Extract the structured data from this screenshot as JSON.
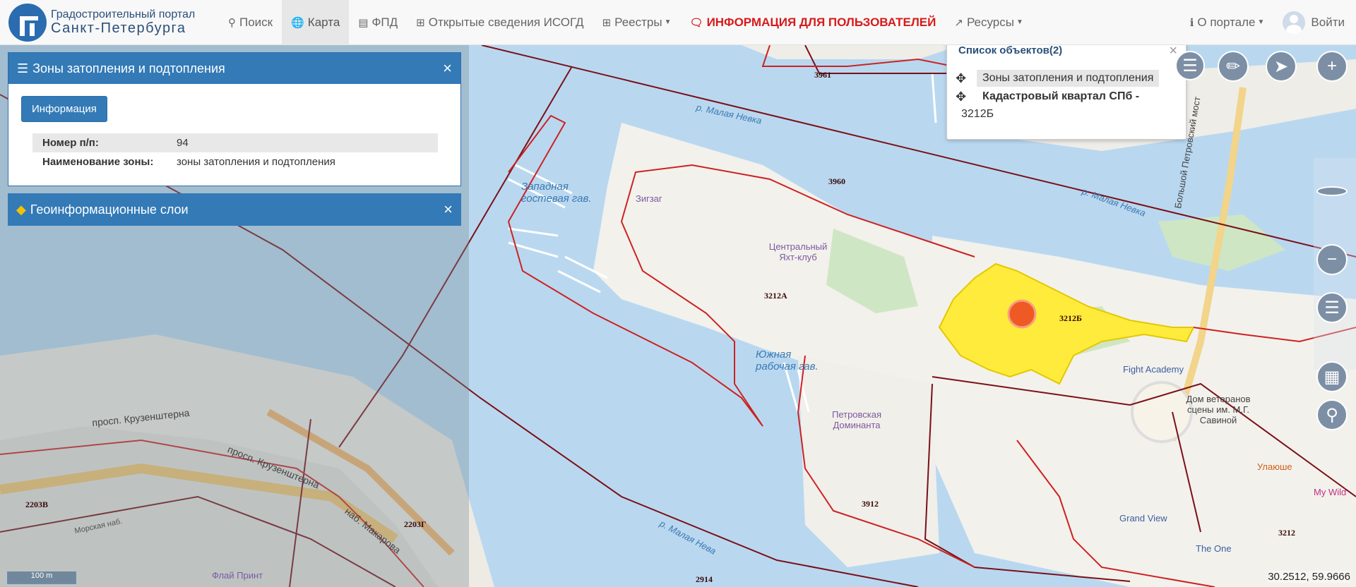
{
  "brand": {
    "line1": "Градостроительный портал",
    "line2": "Санкт-Петербурга"
  },
  "nav": {
    "search": "Поиск",
    "map": "Карта",
    "fpd": "ФПД",
    "isogd": "Открытые сведения ИСОГД",
    "registries": "Реестры",
    "user_info": "ИНФОРМАЦИЯ ДЛЯ ПОЛЬЗОВАТЕЛЕЙ",
    "resources": "Ресурсы",
    "about": "О портале",
    "login": "Войти"
  },
  "zone_panel": {
    "title": "Зоны затопления и подтопления",
    "info_button": "Информация",
    "rows": [
      {
        "key": "Номер п/п:",
        "value": "94"
      },
      {
        "key": "Наименование зоны:",
        "value": "зоны затопления и подтопления"
      }
    ]
  },
  "layers_panel": {
    "title": "Геоинформационные слои"
  },
  "object_list": {
    "title": "Список объектов(2)",
    "items": [
      {
        "label": "Зоны затопления и подтопления"
      },
      {
        "label": "Кадастровый квартал СПб -",
        "label2": "3212Б"
      }
    ]
  },
  "map_labels": {
    "west_harbor": "Западная гостевая гав.",
    "zigzag": "Зигзаг",
    "yacht_club": "Центральный Яхт-клуб",
    "south_harbor": "Южная рабочая гав.",
    "malaya_neva_top": "р. Малая Невка",
    "malaya_neva_right": "р. Малая Невка",
    "malaya_neva_bottom": "р. Малая Нева",
    "krusenstern1": "просп. Крузенштерна",
    "krusenstern2": "просп. Крузенштерна",
    "makarova": "наб. Макарова",
    "morskaya": "Морская наб.",
    "bolshoy_most": "Большой Петровский мост",
    "fight_academy": "Fight Academy",
    "veterans": "Дом ветеранов сцены им. М.Г. Савиной",
    "petrovskaya": "Петровская Доминанта",
    "grand_view": "Grand View",
    "the_one": "The One",
    "ulayashe": "Улаюше",
    "my_wild": "My Wild",
    "flai_print": "Флай Принт",
    "q3961": "3961",
    "q3960": "3960",
    "q3212a": "3212А",
    "q3212b": "3212Б",
    "q3912": "3912",
    "q2914": "2914",
    "q2203v": "2203В",
    "q2203g": "2203Г",
    "q3212": "3212"
  },
  "coordinates": "30.2512, 59.9666",
  "scale": "100 m",
  "colors": {
    "header_blue": "#337ab7",
    "flood_zone": "#ffeb3b",
    "marker": "#ef5a24",
    "boundary": "#7a1018",
    "water": "#b9d8f0",
    "nav_red": "#d81a1a"
  }
}
